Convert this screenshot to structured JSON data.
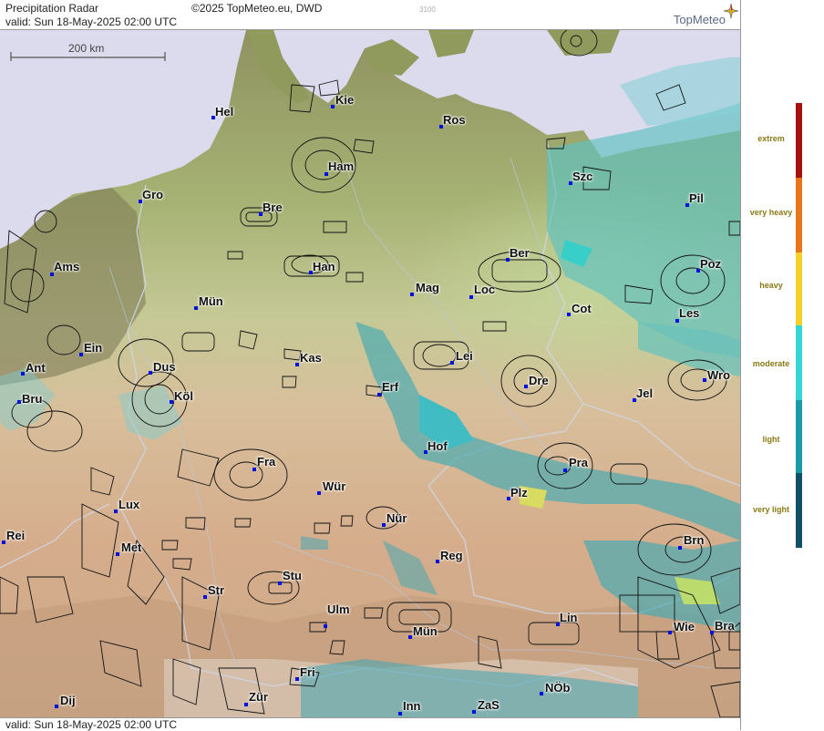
{
  "header": {
    "title": "Precipitation Radar",
    "copyright": "©2025 TopMeteo.eu, DWD",
    "code": "3100",
    "valid": "valid:  Sun  18-May-2025 02:00 UTC",
    "logo": "TopMeteo"
  },
  "footer": {
    "valid": "valid:  Sun  18-May-2025 02:00 UTC"
  },
  "scale": {
    "label": "200 km"
  },
  "legend": {
    "levels": [
      {
        "label": "extrem",
        "color": "#a81010"
      },
      {
        "label": "very heavy",
        "color": "#e8761a"
      },
      {
        "label": "heavy",
        "color": "#f4d22a"
      },
      {
        "label": "moderate",
        "color": "#37d6d6"
      },
      {
        "label": "light",
        "color": "#1b9aa8"
      },
      {
        "label": "very light",
        "color": "#114f66"
      }
    ]
  },
  "cities": [
    {
      "name": "Kie"
    },
    {
      "name": "Hel"
    },
    {
      "name": "Ros"
    },
    {
      "name": "Ham"
    },
    {
      "name": "Szc"
    },
    {
      "name": "Gro"
    },
    {
      "name": "Bre"
    },
    {
      "name": "Pil"
    },
    {
      "name": "Ams"
    },
    {
      "name": "Han"
    },
    {
      "name": "Ber"
    },
    {
      "name": "Poz"
    },
    {
      "name": "Mün"
    },
    {
      "name": "Mag"
    },
    {
      "name": "Loc"
    },
    {
      "name": "Cot"
    },
    {
      "name": "Les"
    },
    {
      "name": "Ein"
    },
    {
      "name": "Kas"
    },
    {
      "name": "Lei"
    },
    {
      "name": "Ant"
    },
    {
      "name": "Dus"
    },
    {
      "name": "Dre"
    },
    {
      "name": "Wro"
    },
    {
      "name": "Bru"
    },
    {
      "name": "Köl"
    },
    {
      "name": "Erf"
    },
    {
      "name": "Jel"
    },
    {
      "name": "Hof"
    },
    {
      "name": "Fra"
    },
    {
      "name": "Pra"
    },
    {
      "name": "Wür"
    },
    {
      "name": "Plz"
    },
    {
      "name": "Lux"
    },
    {
      "name": "Nür"
    },
    {
      "name": "Rei"
    },
    {
      "name": "Met"
    },
    {
      "name": "Reg"
    },
    {
      "name": "Brn"
    },
    {
      "name": "Stu"
    },
    {
      "name": "Str"
    },
    {
      "name": "Ulm"
    },
    {
      "name": "Lin"
    },
    {
      "name": "Mün"
    },
    {
      "name": "Wie"
    },
    {
      "name": "Bra"
    },
    {
      "name": "Fri"
    },
    {
      "name": "NÖb"
    },
    {
      "name": "Dij"
    },
    {
      "name": "Zür"
    },
    {
      "name": "Inn"
    },
    {
      "name": "ZaS"
    }
  ]
}
